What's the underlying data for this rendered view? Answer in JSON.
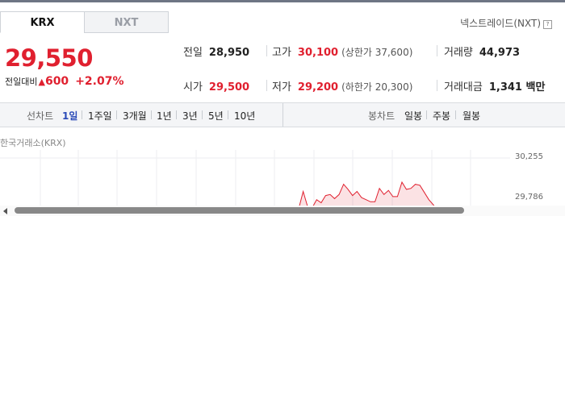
{
  "market_tabs": {
    "active": "KRX",
    "inactive": "NXT"
  },
  "nxt_link": {
    "label": "넥스트레이드(NXT)",
    "help_icon": "?"
  },
  "price": {
    "current": "29,550",
    "change_label": "전일대비",
    "change_amount": "600",
    "change_percent": "+2.07%",
    "direction": "up"
  },
  "stats": {
    "prev_close": {
      "label": "전일",
      "value": "28,950"
    },
    "open": {
      "label": "시가",
      "value": "29,500"
    },
    "high": {
      "label": "고가",
      "value": "30,100",
      "sub": "(상한가 37,600)"
    },
    "low": {
      "label": "저가",
      "value": "29,200",
      "sub": "(하한가 20,300)"
    },
    "volume": {
      "label": "거래량",
      "value": "44,973"
    },
    "amount": {
      "label": "거래대금",
      "value": "1,341 백만"
    }
  },
  "period_bar": {
    "line_label": "선차트",
    "line_periods": [
      "1일",
      "1주일",
      "3개월",
      "1년",
      "3년",
      "5년",
      "10년"
    ],
    "selected": "1일",
    "candle_label": "봉차트",
    "candle_periods": [
      "일봉",
      "주봉",
      "월봉"
    ]
  },
  "chart": {
    "source": "한국거래소(KRX)",
    "y_ticks": [
      "30,255",
      "29,786"
    ]
  },
  "colors": {
    "up": "#e0202f",
    "selected": "#2b4bb8"
  },
  "chart_data": {
    "type": "area",
    "ylim": [
      29550,
      30255
    ],
    "y_ticks": [
      30255,
      29786
    ],
    "values": [
      29695,
      29780,
      29705,
      29620,
      29580,
      29600,
      29650,
      29690,
      29720,
      29760,
      29930,
      29780,
      29770,
      29850,
      29820,
      29890,
      29900,
      29860,
      29900,
      30000,
      29950,
      29890,
      29930,
      29870,
      29850,
      29830,
      29830,
      29960,
      29900,
      29940,
      29880,
      29880,
      30020,
      29950,
      29960,
      30000,
      29990,
      29920,
      29850,
      29800,
      29740,
      29680
    ]
  }
}
